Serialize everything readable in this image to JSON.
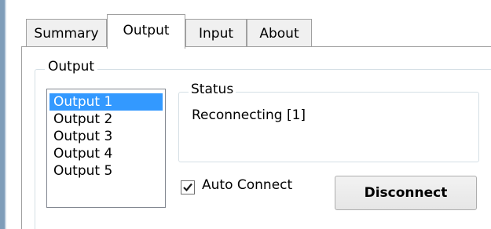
{
  "tabs": [
    {
      "label": "Summary",
      "active": false
    },
    {
      "label": "Output",
      "active": true
    },
    {
      "label": "Input",
      "active": false
    },
    {
      "label": "About",
      "active": false
    }
  ],
  "output_group": {
    "label": "Output",
    "list": [
      "Output 1",
      "Output 2",
      "Output 3",
      "Output 4",
      "Output 5"
    ],
    "selected": "Output 1"
  },
  "status": {
    "label": "Status",
    "text": "Reconnecting [1]"
  },
  "auto_connect": {
    "label": "Auto Connect",
    "checked": true
  },
  "disconnect_button": {
    "label": "Disconnect"
  },
  "colors": {
    "selection": "#3399ff",
    "window_edge": "#7f9db9"
  }
}
